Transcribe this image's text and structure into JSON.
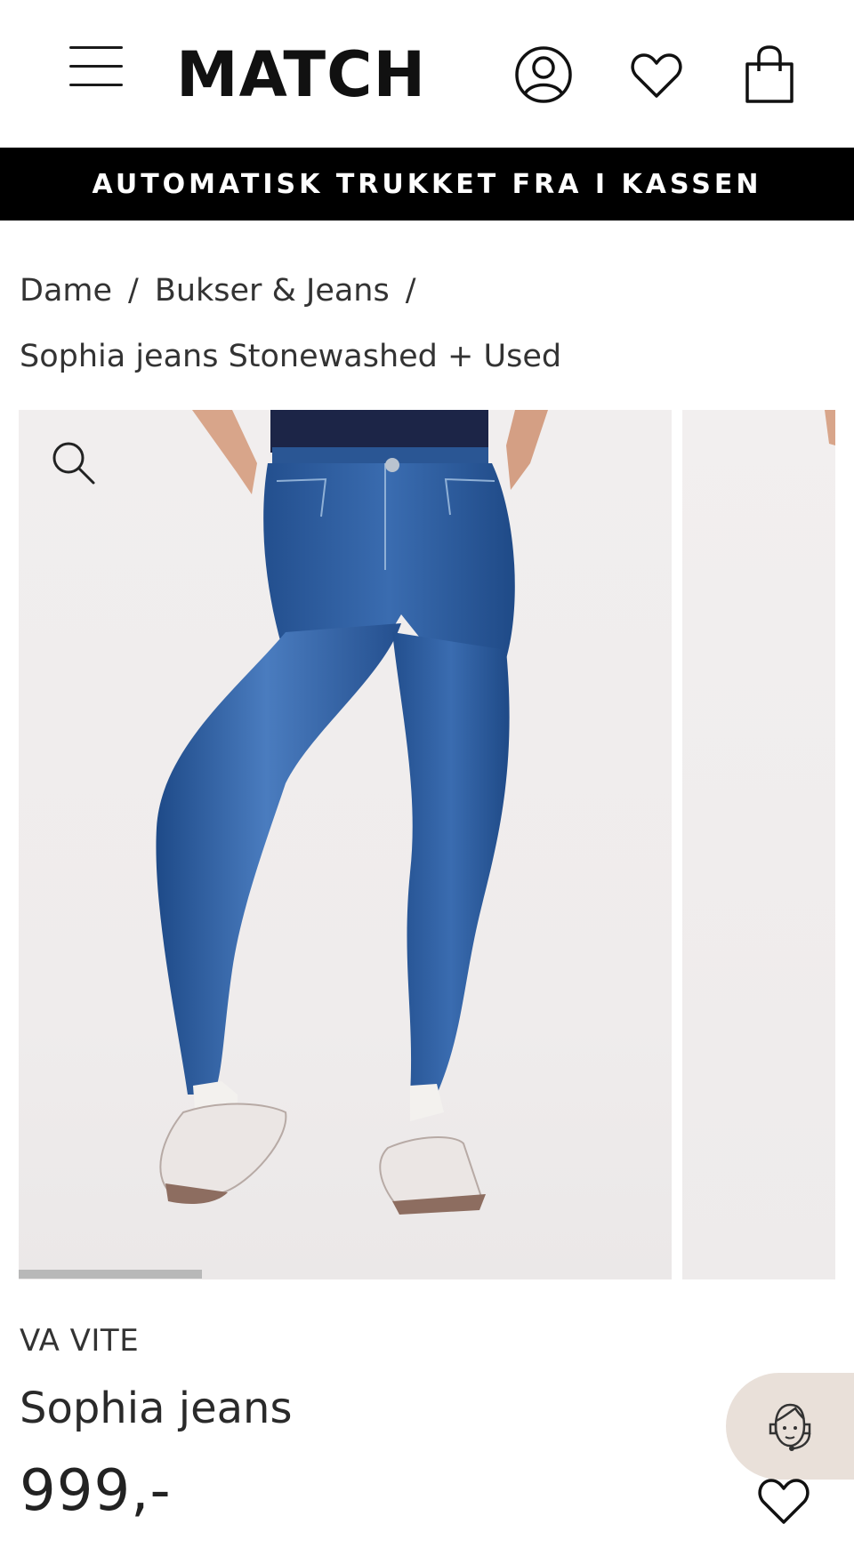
{
  "header": {
    "logo_text": "MATCH",
    "menu_icon": "hamburger-menu-icon",
    "account_icon": "user-icon",
    "wishlist_icon": "heart-icon",
    "cart_icon": "shopping-bag-icon"
  },
  "banner": {
    "text": "AUTOMATISK TRUKKET FRA I KASSEN"
  },
  "breadcrumb": {
    "items": [
      "Dame",
      "Bukser & Jeans"
    ],
    "separator": "/",
    "current": "Sophia jeans Stonewashed + Used"
  },
  "gallery": {
    "zoom_icon": "search-icon",
    "progress_fraction": 0.28
  },
  "product": {
    "brand": "VA VITE",
    "title": "Sophia jeans",
    "price": "999,-"
  },
  "floating": {
    "chat_icon": "support-agent-icon",
    "favorite_icon": "heart-icon"
  },
  "colors": {
    "banner_bg": "#000000",
    "banner_text": "#ffffff",
    "denim": "#2f5f9f",
    "chat_bg": "#e9e0d9"
  }
}
